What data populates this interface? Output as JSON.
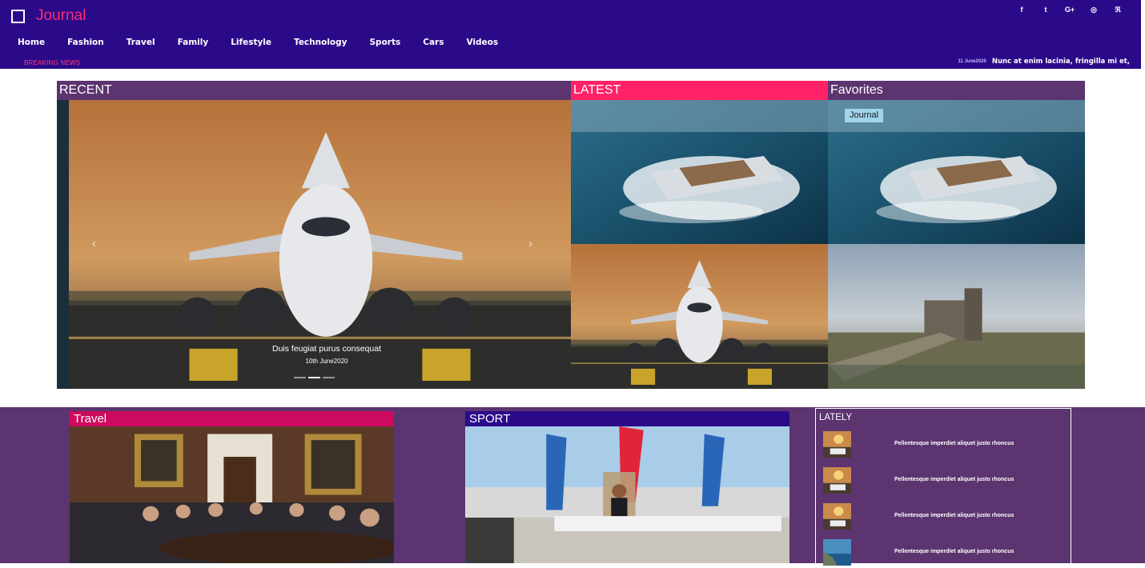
{
  "site": {
    "name": "Journal"
  },
  "social": [
    {
      "icon": "facebook-icon",
      "glyph": "f"
    },
    {
      "icon": "twitter-icon",
      "glyph": "t"
    },
    {
      "icon": "google-plus-icon",
      "glyph": "G+"
    },
    {
      "icon": "instagram-icon",
      "glyph": "◎"
    },
    {
      "icon": "rss-icon",
      "glyph": "ℜ"
    }
  ],
  "nav": [
    "Home",
    "Fashion",
    "Travel",
    "Family",
    "Lifestyle",
    "Technology",
    "Sports",
    "Cars",
    "Videos"
  ],
  "breaking": {
    "label": "BREAKING NEWS",
    "date": "11 June2020",
    "text": "Nunc at enim lacinia, fringilla mi et,"
  },
  "featured": {
    "recent_label": "RECENT",
    "latest_label": "LATEST",
    "favorites_label": "Favorites",
    "slide": {
      "title": "Duis feugiat purus consequat",
      "date": "10th June2020"
    },
    "indicator_count": 3,
    "active_indicator": 2,
    "favorites_tag": "Journal"
  },
  "sections": {
    "travel_label": "Travel",
    "sport_label": "SPORT"
  },
  "lately": {
    "title": "LATELY",
    "items": [
      {
        "text": "Pellentesque imperdiet aliquet justo rhoncus",
        "thumb": "sunset-car"
      },
      {
        "text": "Pellentesque imperdiet aliquet justo rhoncus",
        "thumb": "sunset-car"
      },
      {
        "text": "Pellentesque imperdiet aliquet justo rhoncus",
        "thumb": "sunset-car"
      },
      {
        "text": "Pellentesque imperdiet aliquet justo rhoncus",
        "thumb": "coast"
      }
    ]
  },
  "colors": {
    "header_bg": "#2b0a8a",
    "brand_pink": "#ff2a72",
    "panel_purple": "#5c3470",
    "latest_pink": "#ff2266",
    "travel_crimson": "#cc0a5e",
    "tag_blue": "#9fd4e9"
  }
}
